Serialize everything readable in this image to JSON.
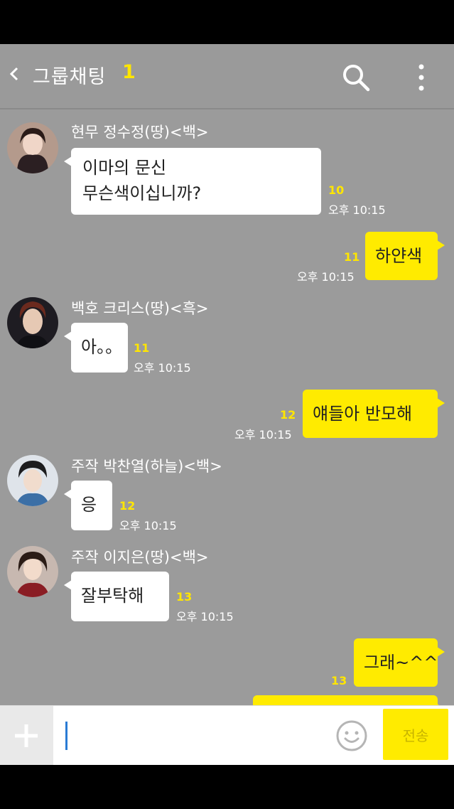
{
  "header": {
    "title": "그룹채팅",
    "member_count": "1",
    "back_icon": "chevron-left-icon",
    "search_icon": "search-icon",
    "more_icon": "more-vertical-icon"
  },
  "messages": [
    {
      "type": "in",
      "sender": "현무 정수정(땅)<백>",
      "lines": [
        "이마의 문신",
        "무슨색이십니까?"
      ],
      "count": "10",
      "time": "오후 10:15"
    },
    {
      "type": "out",
      "text": "하얀색",
      "count": "11",
      "time": "오후 10:15"
    },
    {
      "type": "in",
      "sender": "백호 크리스(땅)<흑>",
      "text": "아。。",
      "count": "11",
      "time": "오후 10:15"
    },
    {
      "type": "out",
      "text": "얘들아 반모해",
      "count": "12",
      "time": "오후 10:15"
    },
    {
      "type": "in",
      "sender": "주작 박찬열(하늘)<백>",
      "text": "응",
      "count": "12",
      "time": "오후 10:15"
    },
    {
      "type": "in",
      "sender": "주작 이지은(땅)<백>",
      "text": "잘부탁해",
      "count": "13",
      "time": "오후 10:15"
    },
    {
      "type": "out",
      "text": "그래~^^",
      "count": "13",
      "time": ""
    }
  ],
  "input": {
    "plus_icon": "plus-icon",
    "emoji_icon": "emoji-icon",
    "send_label": "전송"
  },
  "colors": {
    "chat_bg": "#9b9b9b",
    "header_bg": "#9a9a9a",
    "my_bubble": "#ffeb00",
    "their_bubble": "#ffffff",
    "unread_count": "#ffe600"
  }
}
